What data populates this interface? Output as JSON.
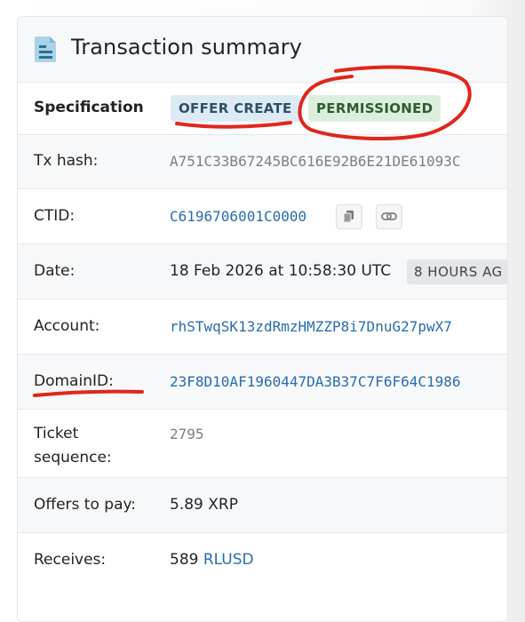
{
  "header": {
    "title": "Transaction summary",
    "icon": "document-icon"
  },
  "specification": {
    "label": "Specification",
    "badges": [
      "OFFER CREATE",
      "PERMISSIONED"
    ]
  },
  "tx_hash": {
    "label": "Tx hash:",
    "value": "A751C33B67245BC616E92B6E21DE61093C"
  },
  "ctid": {
    "label": "CTID:",
    "value": "C6196706001C0000"
  },
  "date": {
    "label": "Date:",
    "value": "18 Feb 2026 at 10:58:30 UTC",
    "relative": "8 HOURS AG"
  },
  "account": {
    "label": "Account:",
    "value": "rhSTwqSK13zdRmzHMZZP8i7DnuG27pwX7"
  },
  "domain_id": {
    "label": "DomainID:",
    "value": "23F8D10AF1960447DA3B37C7F6F64C1986"
  },
  "ticket_sequence": {
    "label_line1": "Ticket",
    "label_line2": "sequence:",
    "value": "2795"
  },
  "offers_to_pay": {
    "label": "Offers to pay:",
    "amount": "5.89",
    "currency": "XRP"
  },
  "receives": {
    "label": "Receives:",
    "amount": "589",
    "currency": "RLUSD"
  },
  "colors": {
    "link": "#2a6bb0",
    "annotation": "#e0261b",
    "offer_badge_bg": "#dcebf3",
    "permissioned_badge_bg": "#dcefdc"
  }
}
